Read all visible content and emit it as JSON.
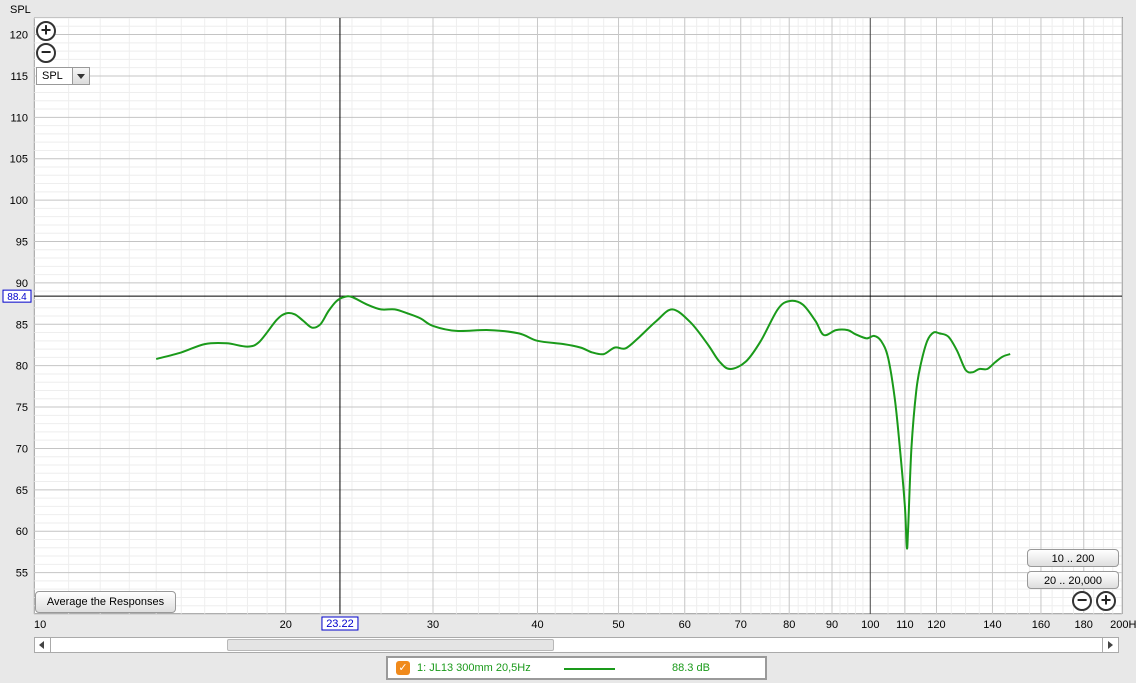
{
  "y_axis_title": "SPL",
  "y_select_value": "SPL",
  "cursor": {
    "y_readout": "88.4",
    "x_readout": "23.22",
    "x_value": 23.22,
    "y_value": 88.4
  },
  "buttons": {
    "average": "Average the Responses",
    "range_10_200": "10 .. 200",
    "range_20_20000": "20 .. 20,000",
    "zoom_in": "+",
    "zoom_out": "−"
  },
  "legend": {
    "checked": "✓",
    "name": "1: JL13 300mm 20,5Hz",
    "value": "88.3 dB"
  },
  "colors": {
    "trace": "#1a9a1a",
    "cursor_label": "#0000cc",
    "checkbox": "#f08a1c"
  },
  "chart_data": {
    "type": "line",
    "x_scale": "log",
    "xlim": [
      10,
      200
    ],
    "ylim": [
      50,
      122
    ],
    "y_ticks": [
      55,
      60,
      65,
      70,
      75,
      80,
      85,
      90,
      95,
      100,
      105,
      110,
      115,
      120
    ],
    "x_ticks": [
      {
        "v": 10,
        "t": "10"
      },
      {
        "v": 20,
        "t": "20"
      },
      {
        "v": 30,
        "t": "30"
      },
      {
        "v": 40,
        "t": "40"
      },
      {
        "v": 50,
        "t": "50"
      },
      {
        "v": 60,
        "t": "60"
      },
      {
        "v": 70,
        "t": "70"
      },
      {
        "v": 80,
        "t": "80"
      },
      {
        "v": 90,
        "t": "90"
      },
      {
        "v": 100,
        "t": "100"
      },
      {
        "v": 110,
        "t": "110"
      },
      {
        "v": 120,
        "t": "120"
      },
      {
        "v": 140,
        "t": "140"
      },
      {
        "v": 160,
        "t": "160"
      },
      {
        "v": 180,
        "t": "180"
      },
      {
        "v": 200,
        "t": "200Hz"
      }
    ],
    "series": [
      {
        "color": "#1a9a1a",
        "x": [
          14.0,
          15.0,
          16.0,
          17.0,
          18.0,
          18.6,
          19.5,
          20.0,
          20.5,
          21.0,
          21.5,
          22.0,
          22.5,
          23.0,
          23.5,
          24.0,
          25.0,
          26.0,
          27.0,
          28.0,
          29.0,
          30.0,
          32.0,
          35.0,
          38.0,
          40.0,
          43.0,
          45.0,
          46.5,
          48.0,
          49.5,
          51.0,
          53.0,
          55.5,
          58.0,
          61.0,
          64.0,
          66.0,
          68.0,
          71.0,
          74.0,
          77.5,
          80.0,
          83.0,
          86.0,
          88.0,
          91.0,
          94.0,
          96.0,
          99.0,
          101.0,
          103.0,
          105.0,
          107.0,
          108.5,
          110.0,
          110.6,
          111.0,
          112.0,
          113.5,
          115.0,
          117.0,
          119.0,
          121.0,
          124.0,
          127.0,
          130.0,
          132.5,
          135.0,
          138.0,
          141.0,
          144.0,
          147.0
        ],
        "values": [
          80.8,
          81.6,
          82.6,
          82.7,
          82.3,
          82.9,
          85.5,
          86.3,
          86.2,
          85.4,
          84.6,
          85.0,
          86.6,
          87.8,
          88.3,
          88.3,
          87.4,
          86.8,
          86.8,
          86.3,
          85.7,
          84.8,
          84.2,
          84.3,
          83.9,
          83.0,
          82.6,
          82.2,
          81.6,
          81.4,
          82.2,
          82.1,
          83.5,
          85.4,
          86.8,
          85.2,
          82.5,
          80.5,
          79.6,
          80.5,
          83.0,
          86.8,
          87.8,
          87.4,
          85.4,
          83.7,
          84.3,
          84.3,
          83.8,
          83.3,
          83.6,
          83.0,
          81.0,
          76.0,
          70.0,
          63.0,
          58.0,
          60.5,
          70.0,
          77.0,
          80.3,
          83.0,
          84.0,
          83.9,
          83.5,
          81.8,
          79.5,
          79.2,
          79.6,
          79.6,
          80.4,
          81.1,
          81.4
        ]
      }
    ]
  }
}
